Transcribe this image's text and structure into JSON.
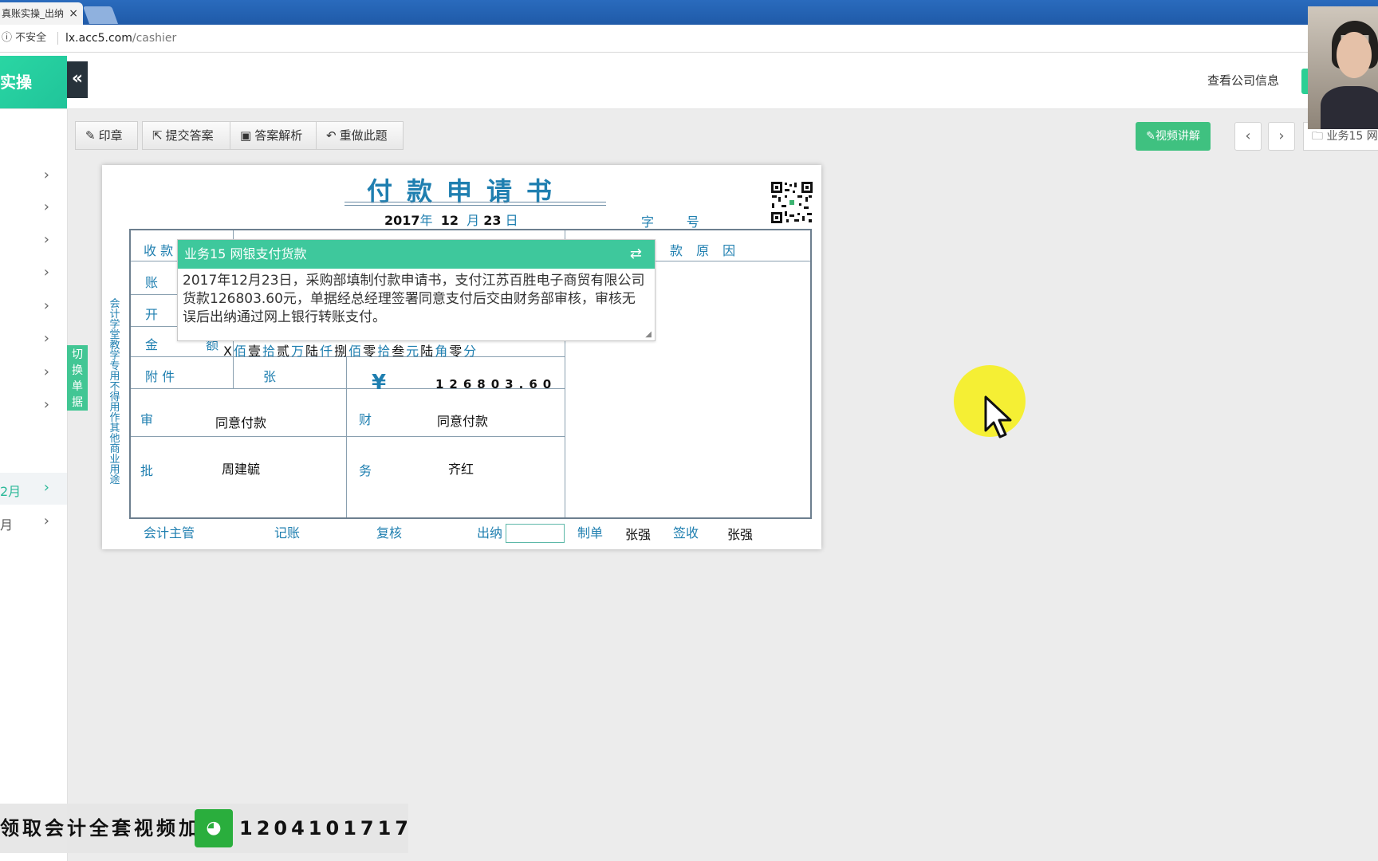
{
  "browser": {
    "tab_title": "真账实操_出纳",
    "tab_close": "×",
    "security": "不安全",
    "url_host": "lx.acc5.com",
    "url_path": "/cashier"
  },
  "header": {
    "brand": "实操",
    "collapse": "«",
    "company_info": "查看公司信息"
  },
  "sidebar": {
    "items": [
      {
        "label": "",
        "chevron": "›"
      },
      {
        "label": "",
        "chevron": "›"
      },
      {
        "label": "",
        "chevron": "›"
      },
      {
        "label": "",
        "chevron": "›"
      },
      {
        "label": "",
        "chevron": "›"
      },
      {
        "label": "",
        "chevron": "›"
      },
      {
        "label": "",
        "chevron": "›"
      },
      {
        "label": "",
        "chevron": "›"
      },
      {
        "label": "2月",
        "chevron": "›"
      },
      {
        "label": "月",
        "chevron": "›"
      }
    ],
    "switch_tab": "切换单据"
  },
  "toolbar": {
    "stamp": "印章",
    "submit": "提交答案",
    "analysis": "答案解析",
    "redo": "重做此题",
    "video": "视频讲解",
    "prev": "‹",
    "next": "›",
    "task": "业务15 网"
  },
  "document": {
    "title": "付款申请书",
    "date_year": "2017",
    "date_month": "12",
    "date_day": "23",
    "u_year": "年",
    "u_month": "月",
    "u_day": "日",
    "zi": "字",
    "hao": "号",
    "side_note": "会计学堂教学专用不得用作其他商业用途",
    "labels": {
      "payee": "收 款",
      "account": "账",
      "bank": "开",
      "amount": "金",
      "amount2": "额",
      "reason": "款 原 因",
      "attach": "附 件",
      "attach_unit": "张",
      "approve1": "审",
      "approve2": "批",
      "finance1": "财",
      "finance2": "务"
    },
    "amount_words": [
      {
        "d": "X",
        "u": "佰"
      },
      {
        "d": "壹",
        "u": "拾"
      },
      {
        "d": "贰",
        "u": "万"
      },
      {
        "d": "陆",
        "u": "仟"
      },
      {
        "d": "捌",
        "u": "佰"
      },
      {
        "d": "零",
        "u": "拾"
      },
      {
        "d": "叁",
        "u": "元"
      },
      {
        "d": "陆",
        "u": "角"
      },
      {
        "d": "零",
        "u": "分"
      }
    ],
    "yen": "¥",
    "amount_num": "126803.60",
    "approve_text": "同意付款",
    "approve_signer": "周建毓",
    "finance_text": "同意付款",
    "finance_signer": "齐红",
    "footer": {
      "accounting_supervisor": "会计主管",
      "bookkeeping": "记账",
      "review": "复核",
      "cashier": "出纳",
      "prepared": "制单",
      "prepared_name": "张强",
      "received": "签收",
      "received_name": "张强"
    }
  },
  "popup": {
    "title": "业务15 网银支付货款",
    "swap": "⇄",
    "body": "2017年12月23日，采购部填制付款申请书，支付江苏百胜电子商贸有限公司货款126803.60元，单据经总经理签署同意支付后交由财务部审核，审核无误后出纳通过网上银行转账支付。"
  },
  "banner": {
    "text1": "领取会计全套视频加",
    "phone": "1204101717"
  },
  "colors": {
    "accent_green": "#3ec89c",
    "form_blue": "#1f7fb0",
    "cursor_spot": "#f6ef2a"
  }
}
